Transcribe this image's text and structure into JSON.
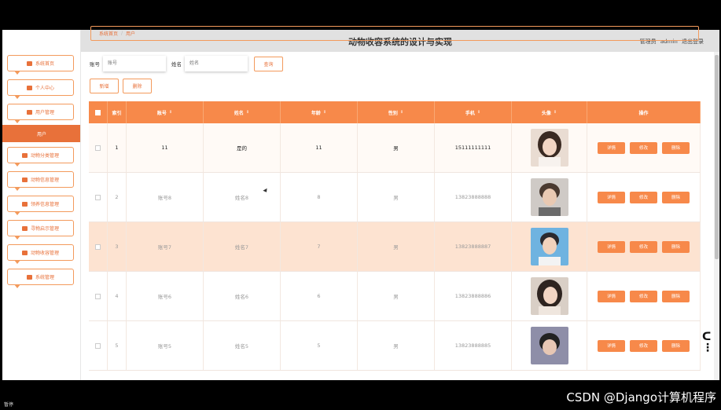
{
  "app": {
    "title": "动物收容系统的设计与实现",
    "admin_role": "管理员",
    "admin_name": "admin",
    "logout": "退出登录"
  },
  "sidebar": {
    "items": [
      {
        "label": "系统首页",
        "icon": "home-icon"
      },
      {
        "label": "个人中心",
        "icon": "user-icon"
      },
      {
        "label": "用户管理",
        "icon": "users-icon"
      },
      {
        "label": "动物分类管理",
        "icon": "category-icon"
      },
      {
        "label": "动物信息管理",
        "icon": "grid-icon"
      },
      {
        "label": "领养信息管理",
        "icon": "grid-icon"
      },
      {
        "label": "寻物启示管理",
        "icon": "shield-icon"
      },
      {
        "label": "动物收容管理",
        "icon": "video-icon"
      },
      {
        "label": "系统管理",
        "icon": "settings-icon"
      }
    ],
    "active_sub": "用户"
  },
  "breadcrumb": {
    "home": "系统首页",
    "sep": "/",
    "current": "用户"
  },
  "search": {
    "account_label": "账号",
    "account_placeholder": "账号",
    "name_label": "姓名",
    "name_placeholder": "姓名",
    "query_button": "查询"
  },
  "actions": {
    "add": "新增",
    "delete": "删除"
  },
  "table": {
    "headers": {
      "index": "索引",
      "account": "账号",
      "name": "姓名",
      "age": "年龄",
      "sex": "性别",
      "phone": "手机",
      "avatar": "头像",
      "ops": "操作"
    },
    "rows": [
      {
        "index": "1",
        "account": "11",
        "name": "是的",
        "age": "11",
        "sex": "男",
        "phone": "15111111111"
      },
      {
        "index": "2",
        "account": "账号8",
        "name": "姓名8",
        "age": "8",
        "sex": "男",
        "phone": "13823888888"
      },
      {
        "index": "3",
        "account": "账号7",
        "name": "姓名7",
        "age": "7",
        "sex": "男",
        "phone": "13823888887"
      },
      {
        "index": "4",
        "account": "账号6",
        "name": "姓名6",
        "age": "6",
        "sex": "男",
        "phone": "13823888886"
      },
      {
        "index": "5",
        "account": "账号5",
        "name": "姓名5",
        "age": "5",
        "sex": "男",
        "phone": "13823888885"
      }
    ],
    "op_labels": {
      "detail": "详情",
      "edit": "修改",
      "delete": "删除"
    }
  },
  "footer": {
    "status": "暂停",
    "watermark": "CSDN @Django计算机程序"
  },
  "colors": {
    "accent": "#f7894a",
    "highlight_row": "#fde3d1"
  }
}
